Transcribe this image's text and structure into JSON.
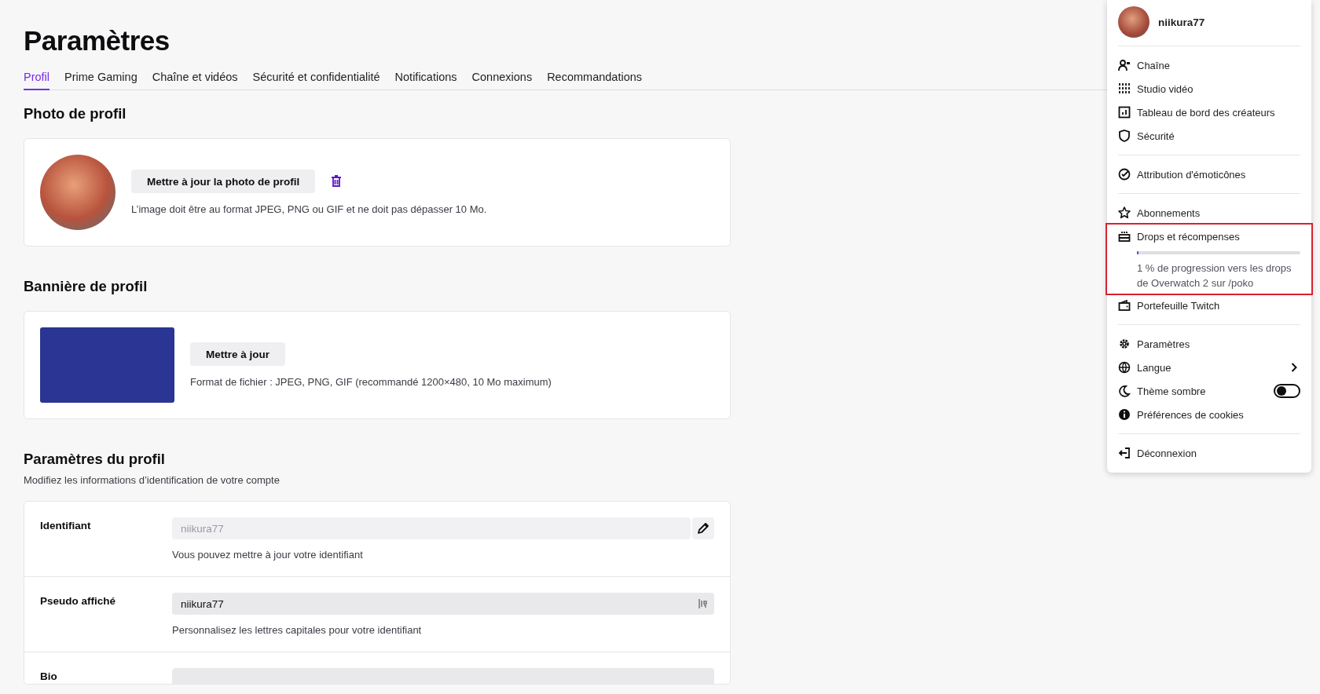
{
  "page": {
    "title": "Paramètres"
  },
  "tabs": [
    {
      "label": "Profil",
      "selected": true
    },
    {
      "label": "Prime Gaming",
      "selected": false
    },
    {
      "label": "Chaîne et vidéos",
      "selected": false
    },
    {
      "label": "Sécurité et confidentialité",
      "selected": false
    },
    {
      "label": "Notifications",
      "selected": false
    },
    {
      "label": "Connexions",
      "selected": false
    },
    {
      "label": "Recommandations",
      "selected": false
    }
  ],
  "profile_photo": {
    "heading": "Photo de profil",
    "button": "Mettre à jour la photo de profil",
    "hint": "L’image doit être au format JPEG, PNG ou GIF et ne doit pas dépasser 10 Mo."
  },
  "profile_banner": {
    "heading": "Bannière de profil",
    "button": "Mettre à jour",
    "hint": "Format de fichier : JPEG, PNG, GIF (recommandé 1200×480, 10 Mo maximum)"
  },
  "profile_settings": {
    "heading": "Paramètres du profil",
    "subtitle": "Modifiez les informations d’identification de votre compte",
    "rows": [
      {
        "label": "Identifiant",
        "value": "niikura77",
        "disabled": true,
        "kind": "editable",
        "hint": "Vous pouvez mettre à jour votre identifiant"
      },
      {
        "label": "Pseudo affiché",
        "value": "niikura77",
        "disabled": false,
        "kind": "text",
        "hint": "Personnalisez les lettres capitales pour votre identifiant"
      },
      {
        "label": "Bio",
        "kind": "textarea"
      }
    ]
  },
  "user_menu": {
    "username": "niikura77",
    "groups": [
      [
        {
          "label": "Chaîne",
          "kind": "link",
          "highlighted": false
        },
        {
          "label": "Studio vidéo",
          "kind": "link",
          "highlighted": false
        },
        {
          "label": "Tableau de bord des créateurs",
          "kind": "link",
          "highlighted": false
        },
        {
          "label": "Sécurité",
          "kind": "link",
          "highlighted": false
        }
      ],
      [
        {
          "label": "Attribution d'émoticônes",
          "kind": "link",
          "highlighted": false
        }
      ],
      [
        {
          "label": "Abonnements",
          "kind": "link",
          "highlighted": false
        },
        {
          "label": "Drops et récompenses",
          "kind": "progress",
          "level": 0.01,
          "progress_text": "1 % de progression vers les drops de Overwatch 2 sur /poko",
          "highlighted": true
        },
        {
          "label": "Portefeuille Twitch",
          "kind": "link",
          "highlighted": false
        }
      ],
      [
        {
          "label": "Paramètres",
          "kind": "link",
          "highlighted": false
        },
        {
          "label": "Langue",
          "kind": "submenu",
          "highlighted": false
        },
        {
          "label": "Thème sombre",
          "kind": "toggle",
          "on": false,
          "highlighted": false
        },
        {
          "label": "Préférences de cookies",
          "kind": "link",
          "highlighted": false
        }
      ],
      [
        {
          "label": "Déconnexion",
          "kind": "link",
          "highlighted": false
        }
      ]
    ]
  }
}
